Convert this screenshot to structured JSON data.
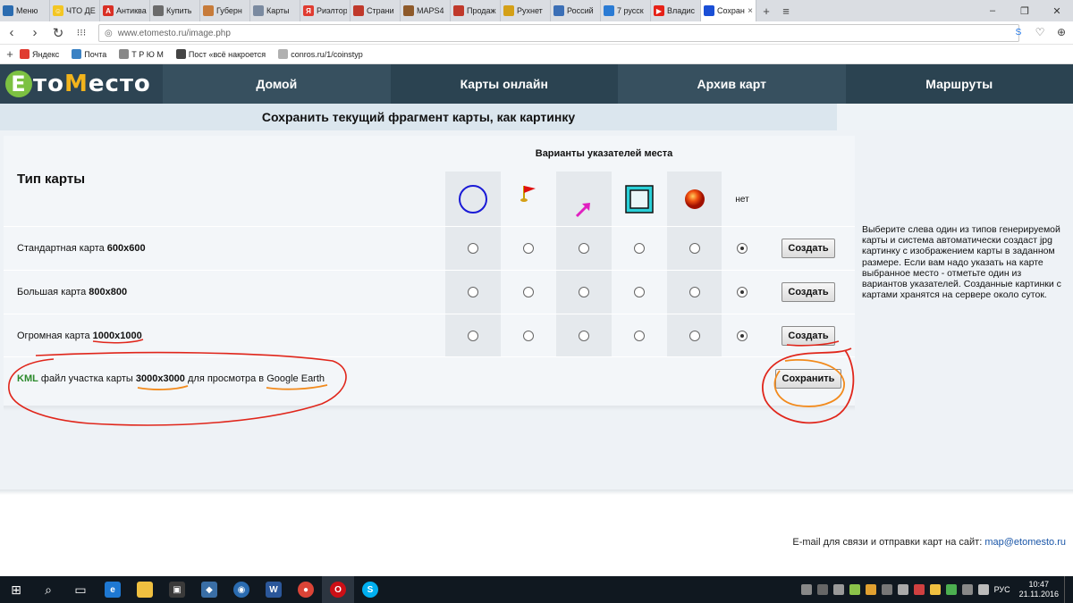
{
  "browser": {
    "tabs": [
      {
        "label": "Меню",
        "color": "#2b6cb0",
        "glyph": ""
      },
      {
        "label": "ЧТО ДЕ",
        "color": "#f3c623",
        "glyph": "☺"
      },
      {
        "label": "Антиква",
        "color": "#d93025",
        "glyph": "A"
      },
      {
        "label": "Купить",
        "color": "#6b6b6b",
        "glyph": ""
      },
      {
        "label": "Губерн",
        "color": "#c77b3a",
        "glyph": ""
      },
      {
        "label": "Карты",
        "color": "#7a8aa0",
        "glyph": ""
      },
      {
        "label": "Риэлтор",
        "color": "#e03c31",
        "glyph": "Я"
      },
      {
        "label": "Страни",
        "color": "#c0392b",
        "glyph": ""
      },
      {
        "label": "MAPS4",
        "color": "#8e5a2a",
        "glyph": ""
      },
      {
        "label": "Продаж",
        "color": "#c0392b",
        "glyph": ""
      },
      {
        "label": "Рухнет",
        "color": "#d4a017",
        "glyph": ""
      },
      {
        "label": "Россий",
        "color": "#3b6fb6",
        "glyph": ""
      },
      {
        "label": "7 русск",
        "color": "#2a7bd4",
        "glyph": ""
      },
      {
        "label": "Владис",
        "color": "#e62117",
        "glyph": "▶"
      },
      {
        "label": "Сохран",
        "color": "#1a4fd6",
        "glyph": ""
      }
    ],
    "url": "www.etomesto.ru/image.php",
    "bookmarks": [
      {
        "label": "Яндекс",
        "color": "#e03c31"
      },
      {
        "label": "Почта",
        "color": "#3b82c4"
      },
      {
        "label": "Т Р Ю М",
        "color": "#888888"
      },
      {
        "label": "Пост «всё накроется",
        "color": "#444444"
      },
      {
        "label": "conros.ru/1/coinstyp",
        "color": "#b0b0b0"
      }
    ]
  },
  "site": {
    "logo": {
      "e": "Е",
      "part1": "то",
      "m": "М",
      "part2": "есто"
    },
    "nav": [
      "Домой",
      "Карты онлайн",
      "Архив карт",
      "Маршруты"
    ],
    "subtitle": "Сохранить текущий фрагмент карты, как картинку",
    "table": {
      "type_header": "Тип карты",
      "variants_header": "Варианты указателей места",
      "none_label": "нет",
      "rows": [
        {
          "label": "Стандартная карта",
          "size": "600x600",
          "button": "Создать",
          "selected": 5
        },
        {
          "label": "Большая карта",
          "size": "800x800",
          "button": "Создать",
          "selected": 5
        },
        {
          "label": "Огромная карта",
          "size": "1000x1000",
          "button": "Создать",
          "selected": 5
        }
      ],
      "kml": {
        "kml": "KML",
        "t1": "файл участка карты",
        "size": "3000x3000",
        "t2": "для просмотра в",
        "target": "Google Earth",
        "button": "Сохранить"
      }
    },
    "info": "Выберите слева один из типов генерируемой карты и система автоматически создаст jpg картинку с изображением карты в заданном размере. Если вам надо указать на карте выбранное место - отметьте один из вариантов указателей. Созданные картинки с картами хранятся на сервере около суток.",
    "footer": {
      "text": "E-mail для связи и отправки карт на сайт:",
      "email": "map@etomesto.ru"
    }
  },
  "taskbar": {
    "lang": "РУС",
    "time": "10:47",
    "date": "21.11.2016"
  }
}
